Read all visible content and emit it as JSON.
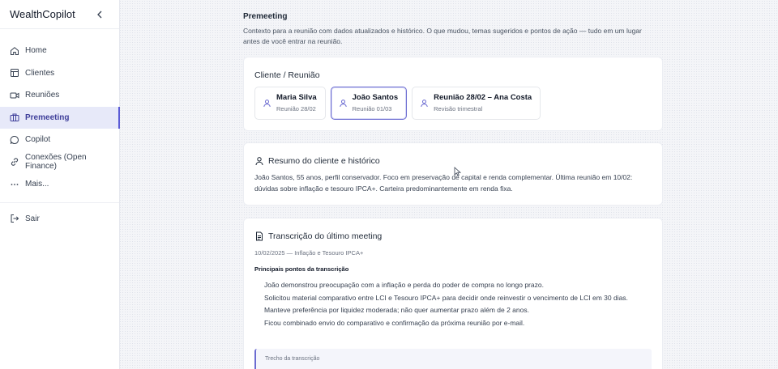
{
  "app": {
    "brand": "WealthCopilot"
  },
  "sidebar": {
    "items": [
      {
        "label": "Home",
        "icon": "home-icon"
      },
      {
        "label": "Clientes",
        "icon": "table-icon"
      },
      {
        "label": "Reuniões",
        "icon": "video-icon"
      },
      {
        "label": "Premeeting",
        "icon": "briefcase-icon",
        "active": true
      },
      {
        "label": "Copilot",
        "icon": "chat-icon"
      },
      {
        "label": "Conexões (Open Finance)",
        "icon": "link-icon"
      },
      {
        "label": "Mais...",
        "icon": "more-icon"
      }
    ],
    "logout": {
      "label": "Sair",
      "icon": "logout-icon"
    }
  },
  "page": {
    "title": "Premeeting",
    "description": "Contexto para a reunião com dados atualizados e histórico. O que mudou, temas sugeridos e pontos de ação — tudo em um lugar antes de você entrar na reunião."
  },
  "client_section": {
    "title": "Cliente / Reunião",
    "clients": [
      {
        "name": "Maria Silva",
        "sub": "Reunião 28/02",
        "selected": false
      },
      {
        "name": "João Santos",
        "sub": "Reunião 01/03",
        "selected": true
      },
      {
        "name": "Reunião 28/02 – Ana Costa",
        "sub": "Revisão trimestral",
        "selected": false
      }
    ]
  },
  "summary": {
    "title": "Resumo do cliente e histórico",
    "text": "João Santos, 55 anos, perfil conservador. Foco em preservação de capital e renda complementar. Última reunião em 10/02: dúvidas sobre inflação e tesouro IPCA+. Carteira predominantemente em renda fixa."
  },
  "transcript": {
    "title": "Transcrição do último meeting",
    "meta": "10/02/2025 — Inflação e Tesouro IPCA+",
    "points_heading": "Principais pontos da transcrição",
    "points": [
      "João demonstrou preocupação com a inflação e perda do poder de compra no longo prazo.",
      "Solicitou material comparativo entre LCI e Tesouro IPCA+ para decidir onde reinvestir o vencimento de LCI em 30 dias.",
      "Manteve preferência por liquidez moderada; não quer aumentar prazo além de 2 anos.",
      "Ficou combinado envio do comparativo e confirmação da próxima reunião por e-mail."
    ],
    "excerpt_label": "Trecho da transcrição"
  },
  "colors": {
    "accent": "#5b5bd6",
    "active_bg": "#e7e9f9"
  }
}
